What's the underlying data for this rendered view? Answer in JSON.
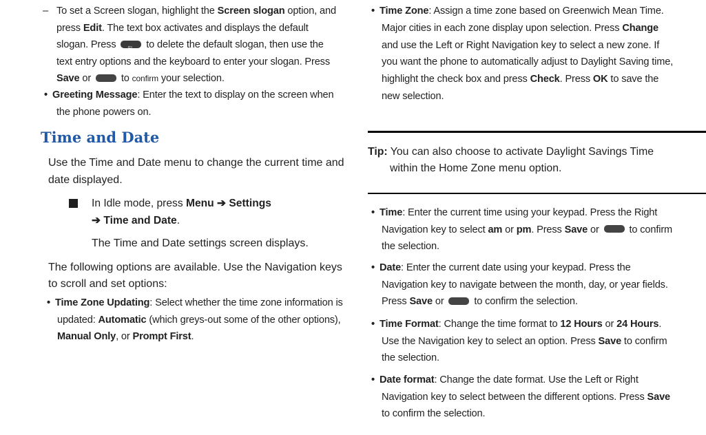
{
  "left": {
    "slogan": {
      "dash": "–",
      "l1_pre": "To set a Screen slogan, highlight the ",
      "l1_b": "Screen slogan",
      "l1_post": " option, and",
      "l2_pre": "press ",
      "l2_b": "Edit",
      "l2_post": ". The text box activates and displays the default",
      "l3_pre": "slogan. Press ",
      "l3_post": " to delete the default slogan, then use the",
      "l4": "text entry options and the keyboard to enter your slogan. Press",
      "l5_b": "Save",
      "l5_mid": " or ",
      "l5_post": " to ",
      "l5_small": "confirm",
      "l5_end": " your selection."
    },
    "greeting": {
      "label": "Greeting Message",
      "l1": ": Enter the text to display on the screen when",
      "l2": "the phone powers on."
    },
    "heading": "Time and Date",
    "intro_l1": "Use the Time and Date menu to change the current time and",
    "intro_l2": "date displayed.",
    "step": {
      "pre": "In Idle mode, press ",
      "menu": "Menu",
      "arrow1": " ➔ ",
      "settings": "Settings",
      "arrow2": "➔ ",
      "time_date": "Time and Date",
      "period": ".",
      "result": "The Time and Date settings screen displays."
    },
    "options_l1": "The following options are available. Use the Navigation keys",
    "options_l2": "to scroll and set options:",
    "tz_updating": {
      "label": "Time Zone Updating",
      "l1": ": Select whether the time zone information is",
      "l2_pre": "updated: ",
      "l2_b": "Automatic",
      "l2_post": " (which greys-out some of the other options),",
      "l3_b1": "Manual Only",
      "l3_mid": ", or ",
      "l3_b2": "Prompt First",
      "l3_end": "."
    }
  },
  "right": {
    "timezone": {
      "label": "Time Zone",
      "l1": ": Assign a time zone based on Greenwich Mean Time.",
      "l2_pre": "Major cities in each zone display upon selection. Press ",
      "l2_b": "Change",
      "l3": "and use the Left or Right Navigation key to select a new zone. If",
      "l4": "you want the phone to automatically adjust to Daylight Saving time,",
      "l5_pre": "highlight the check box and press ",
      "l5_b": "Check",
      "l5_mid": ". Press ",
      "l5_b2": "OK",
      "l5_post": " to save the",
      "l6": "new selection."
    },
    "tip": {
      "label": "Tip:",
      "l1": " You can also choose to activate Daylight Savings Time",
      "l2": "within the Home Zone menu option."
    },
    "time": {
      "label": "Time",
      "l1": ": Enter the current time using your keypad. Press the Right",
      "l2_pre": "Navigation key to select ",
      "l2_am": "am",
      "l2_or": " or ",
      "l2_pm": "pm",
      "l2_mid": ". Press ",
      "l2_save": "Save",
      "l2_or2": " or ",
      "l2_post": " to confirm",
      "l3": "the selection."
    },
    "date": {
      "label": "Date",
      "l1": ": Enter the current date using your keypad. Press the",
      "l2": "Navigation key to navigate between the month, day, or year fields.",
      "l3_pre": "Press ",
      "l3_b": "Save",
      "l3_mid": " or ",
      "l3_post": " to confirm the selection."
    },
    "time_format": {
      "label": "Time Format",
      "l1_pre": ": Change the time format to ",
      "l1_b1": "12 Hours",
      "l1_mid": " or ",
      "l1_b2": "24 Hours",
      "l1_end": ".",
      "l2_pre": "Use the Navigation key to select an option. Press ",
      "l2_b": "Save",
      "l2_post": " to confirm",
      "l3": "the selection."
    },
    "date_format": {
      "label": "Date format",
      "l1": ": Change the date format. Use the Left or Right",
      "l2_pre": "Navigation key to select between the different options. Press ",
      "l2_b": "Save",
      "l3": "to confirm the selection."
    }
  },
  "colors": {
    "heading": "#2159a6",
    "text": "#222222"
  },
  "icons": [
    "clear-key-icon",
    "softkey-icon",
    "square-bullet-icon"
  ]
}
